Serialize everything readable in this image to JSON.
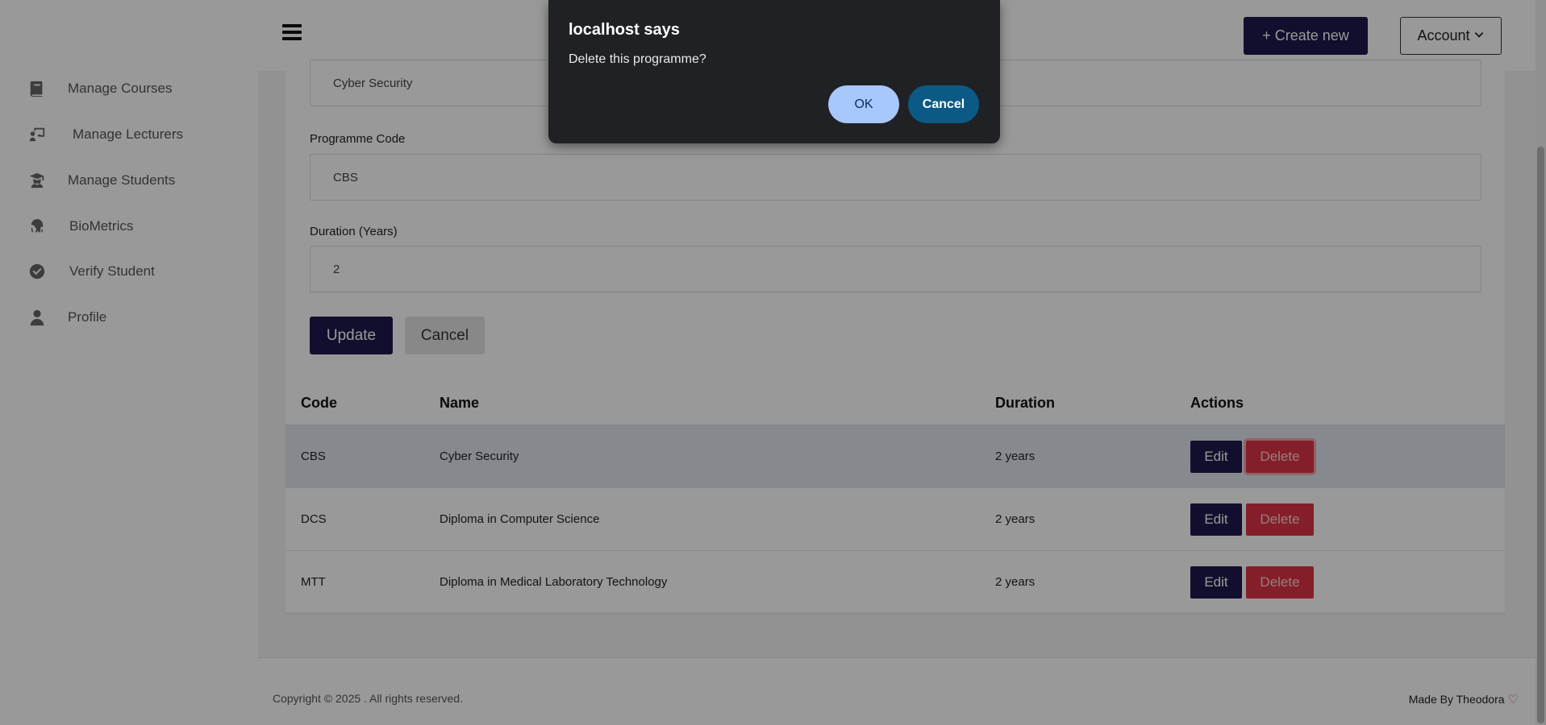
{
  "sidebar": {
    "items": [
      {
        "label": "Manage Courses",
        "icon": "book-icon"
      },
      {
        "label": "Manage Lecturers",
        "icon": "chalkboard-teacher-icon"
      },
      {
        "label": "Manage Students",
        "icon": "graduate-icon"
      },
      {
        "label": "BioMetrics",
        "icon": "fingerprint-icon"
      },
      {
        "label": "Verify Student",
        "icon": "check-circle-icon"
      },
      {
        "label": "Profile",
        "icon": "user-icon"
      }
    ]
  },
  "header": {
    "create_label": "+ Create new",
    "account_label": "Account"
  },
  "form": {
    "name_value": "Cyber Security",
    "code_label": "Programme Code",
    "code_value": "CBS",
    "duration_label": "Duration (Years)",
    "duration_value": "2",
    "update_label": "Update",
    "cancel_label": "Cancel"
  },
  "table": {
    "headers": [
      "Code",
      "Name",
      "Duration",
      "Actions"
    ],
    "rows": [
      {
        "code": "CBS",
        "name": "Cyber Security",
        "duration": "2 years"
      },
      {
        "code": "DCS",
        "name": "Diploma in Computer Science",
        "duration": "2 years"
      },
      {
        "code": "MTT",
        "name": "Diploma in Medical Laboratory Technology",
        "duration": "2 years"
      }
    ],
    "edit_label": "Edit",
    "delete_label": "Delete"
  },
  "footer": {
    "copyright": "Copyright © 2025 . All rights reserved.",
    "made_by": "Made By Theodora",
    "heart_icon": "heart-icon"
  },
  "dialog": {
    "title": "localhost says",
    "message": "Delete this programme?",
    "ok_label": "OK",
    "cancel_label": "Cancel"
  },
  "colors": {
    "brand": "#1f1a4d",
    "danger": "#dc3545",
    "dialog_bg": "#202124",
    "dialog_ok": "#a8c7fa",
    "dialog_cancel": "#0b5a86"
  }
}
